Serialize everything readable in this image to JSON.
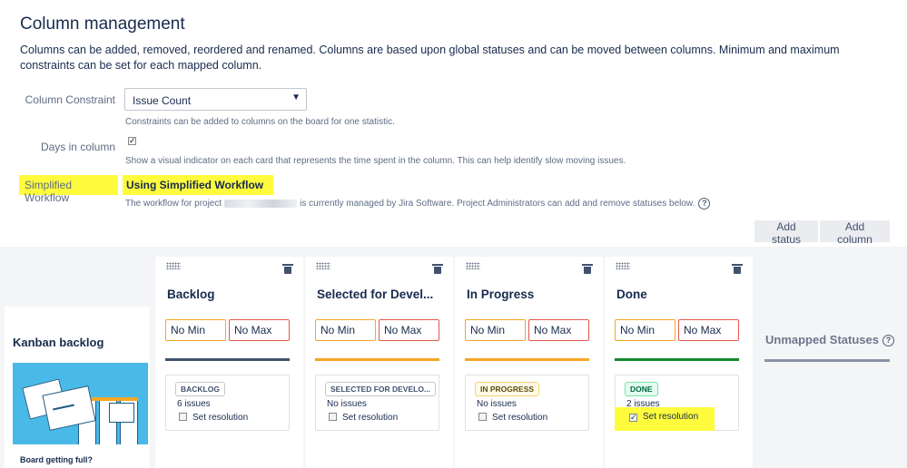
{
  "page": {
    "title": "Column management",
    "description": "Columns can be added, removed, reordered and renamed. Columns are based upon global statuses and can be moved between columns. Minimum and maximum constraints can be set for each mapped column."
  },
  "settings": {
    "constraint_label": "Column Constraint",
    "constraint_value": "Issue Count",
    "constraint_help": "Constraints can be added to columns on the board for one statistic.",
    "days_label": "Days in column",
    "days_checked": true,
    "days_help": "Show a visual indicator on each card that represents the time spent in the column. This can help identify slow moving issues.",
    "workflow_label": "Simplified Workflow",
    "workflow_value": "Using Simplified Workflow",
    "workflow_help_prefix": "The workflow for project",
    "workflow_help_suffix": "is currently managed by Jira Software. Project Administrators can add and remove statuses below."
  },
  "actions": {
    "add_status": "Add status",
    "add_column": "Add column"
  },
  "backlog": {
    "title": "Kanban backlog",
    "cta": "Board getting full?"
  },
  "columns": [
    {
      "name": "Backlog",
      "min": "No Min",
      "max": "No Max",
      "bar_color": "#42526e",
      "status": "BACKLOG",
      "status_style": "default",
      "issues": "6 issues",
      "resolution": "Set resolution",
      "resolution_checked": false
    },
    {
      "name": "Selected for Devel...",
      "min": "No Min",
      "max": "No Max",
      "bar_color": "#f6a623",
      "status": "SELECTED FOR DEVELO...",
      "status_style": "default",
      "issues": "No issues",
      "resolution": "Set resolution",
      "resolution_checked": false
    },
    {
      "name": "In Progress",
      "min": "No Min",
      "max": "No Max",
      "bar_color": "#f6a623",
      "status": "IN PROGRESS",
      "status_style": "inprog",
      "issues": "No issues",
      "resolution": "Set resolution",
      "resolution_checked": false
    },
    {
      "name": "Done",
      "min": "No Min",
      "max": "No Max",
      "bar_color": "#14892c",
      "status": "DONE",
      "status_style": "done",
      "issues": "2 issues",
      "resolution": "Set resolution",
      "resolution_checked": true
    }
  ],
  "unmapped": {
    "title": "Unmapped Statuses"
  },
  "colors": {
    "highlight": "#fffb3d",
    "board_bg": "#f4f5f7"
  },
  "icons": [
    "chevron-down-icon",
    "checkbox-icon",
    "help-icon",
    "drag-handle-icon",
    "trash-icon"
  ]
}
